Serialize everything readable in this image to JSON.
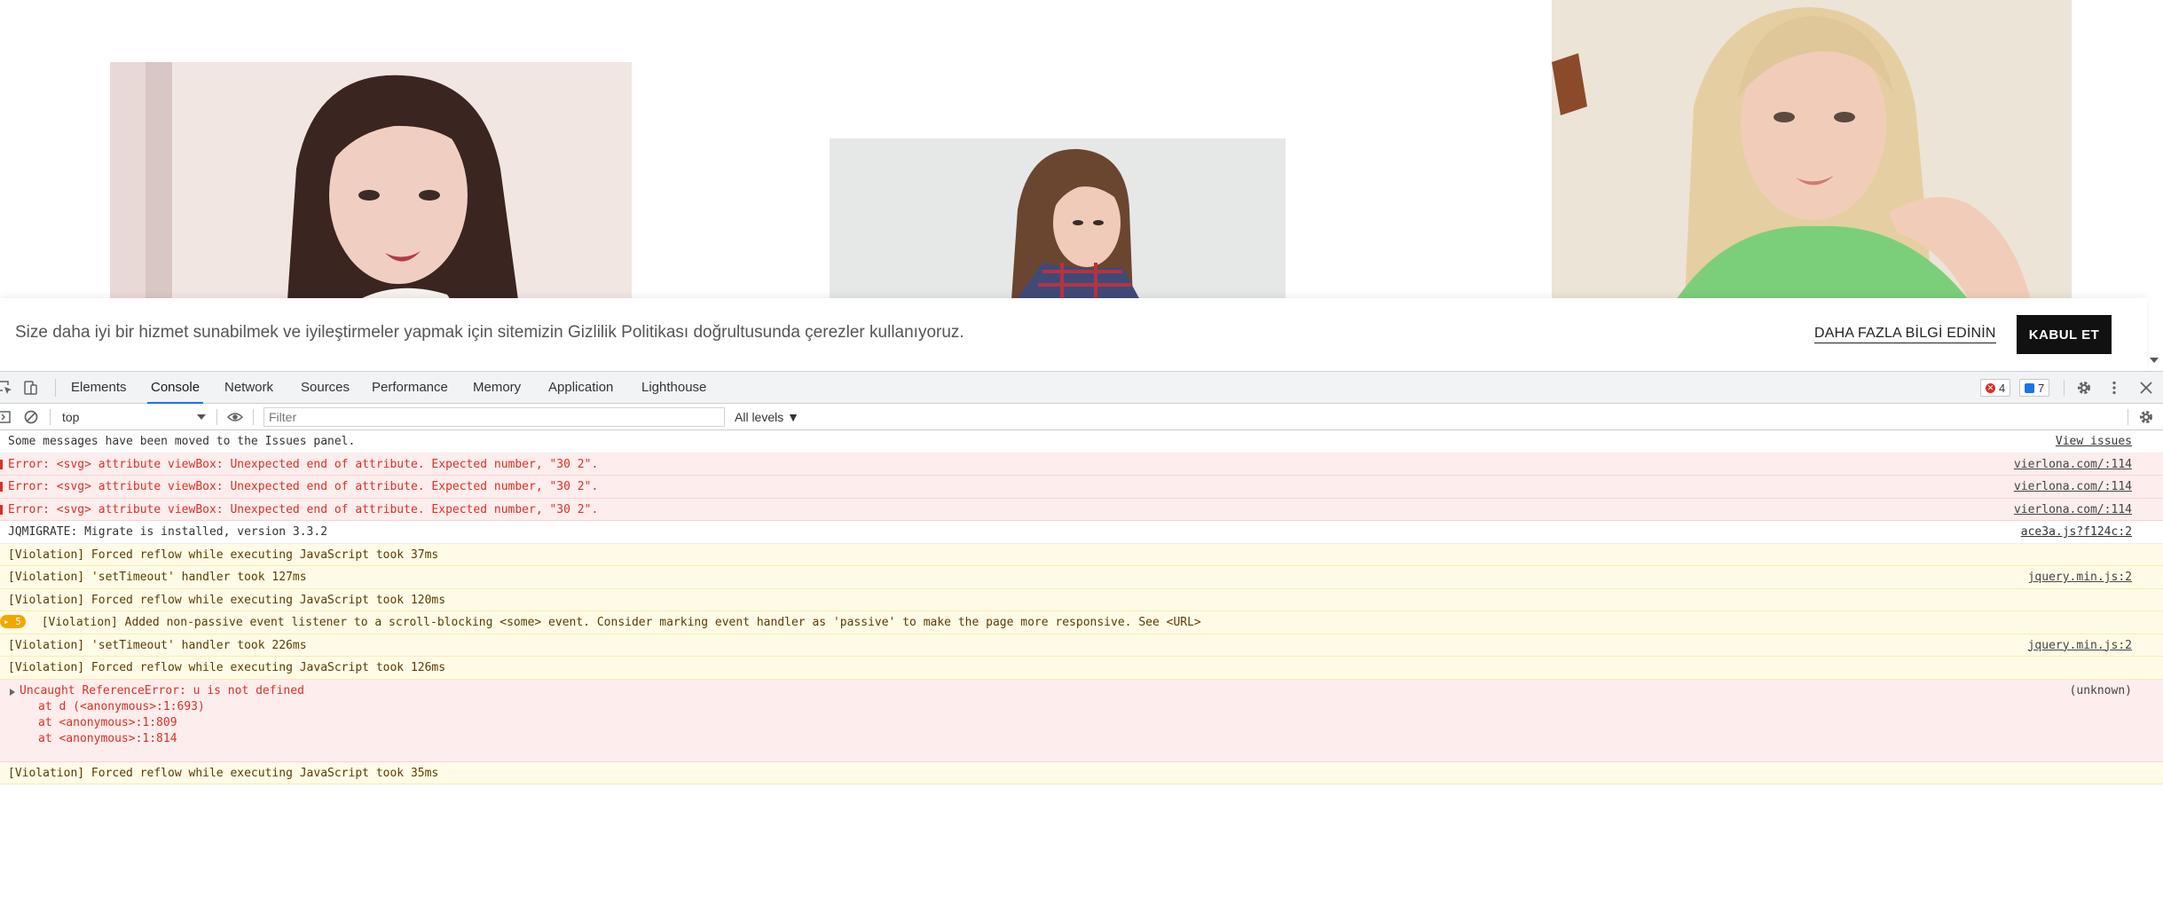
{
  "cookie_bar": {
    "text": "Size daha iyi bir hizmet sunabilmek ve iyileştirmeler yapmak için sitemizin Gizlilik Politikası doğrultusunda çerezler kullanıyoruz.",
    "more_label": "DAHA FAZLA BİLGİ EDİNİN",
    "accept_label": "KABUL ET"
  },
  "devtools": {
    "tabs": [
      "Elements",
      "Console",
      "Network",
      "Sources",
      "Performance",
      "Memory",
      "Application",
      "Lighthouse"
    ],
    "active_tab": "Console",
    "error_count": "4",
    "issue_count": "7",
    "context": "top",
    "filter_placeholder": "Filter",
    "levels_label": "All levels ▼",
    "messages": [
      {
        "text": "Some messages have been moved to the Issues panel.",
        "source": "View issues"
      },
      {
        "text": "Error: <svg> attribute viewBox: Unexpected end of attribute. Expected number, \"30 2\".",
        "source": "vierlona.com/:114"
      },
      {
        "text": "Error: <svg> attribute viewBox: Unexpected end of attribute. Expected number, \"30 2\".",
        "source": "vierlona.com/:114"
      },
      {
        "text": "Error: <svg> attribute viewBox: Unexpected end of attribute. Expected number, \"30 2\".",
        "source": "vierlona.com/:114"
      },
      {
        "text": "JQMIGRATE: Migrate is installed, version 3.3.2",
        "source": "ace3a.js?f124c:2"
      },
      {
        "text": "[Violation] Forced reflow while executing JavaScript took 37ms",
        "source": ""
      },
      {
        "text": "[Violation] 'setTimeout' handler took 127ms",
        "source": "jquery.min.js:2"
      },
      {
        "text": "[Violation] Forced reflow while executing JavaScript took 120ms",
        "source": ""
      },
      {
        "count": "5",
        "text": "[Violation] Added non-passive event listener to a scroll-blocking <some> event. Consider marking event handler as 'passive' to make the page more responsive. See <URL>",
        "source": ""
      },
      {
        "text": "[Violation] 'setTimeout' handler took 226ms",
        "source": "jquery.min.js:2"
      },
      {
        "text": "[Violation] Forced reflow while executing JavaScript took 126ms",
        "source": ""
      },
      {
        "text": "Uncaught ReferenceError: u is not defined",
        "stack": [
          "at d (<anonymous>:1:693)",
          "at <anonymous>:1:809",
          "at <anonymous>:1:814"
        ],
        "source": "(unknown)"
      },
      {
        "text": "[Violation] Forced reflow while executing JavaScript took 35ms",
        "source": ""
      }
    ]
  },
  "colors": {
    "accent": "#1a73e8",
    "error_text": "#d93025",
    "error_bg": "#fdeded",
    "warn_bg": "#fffbe6",
    "warn_badge": "#f2a600"
  }
}
